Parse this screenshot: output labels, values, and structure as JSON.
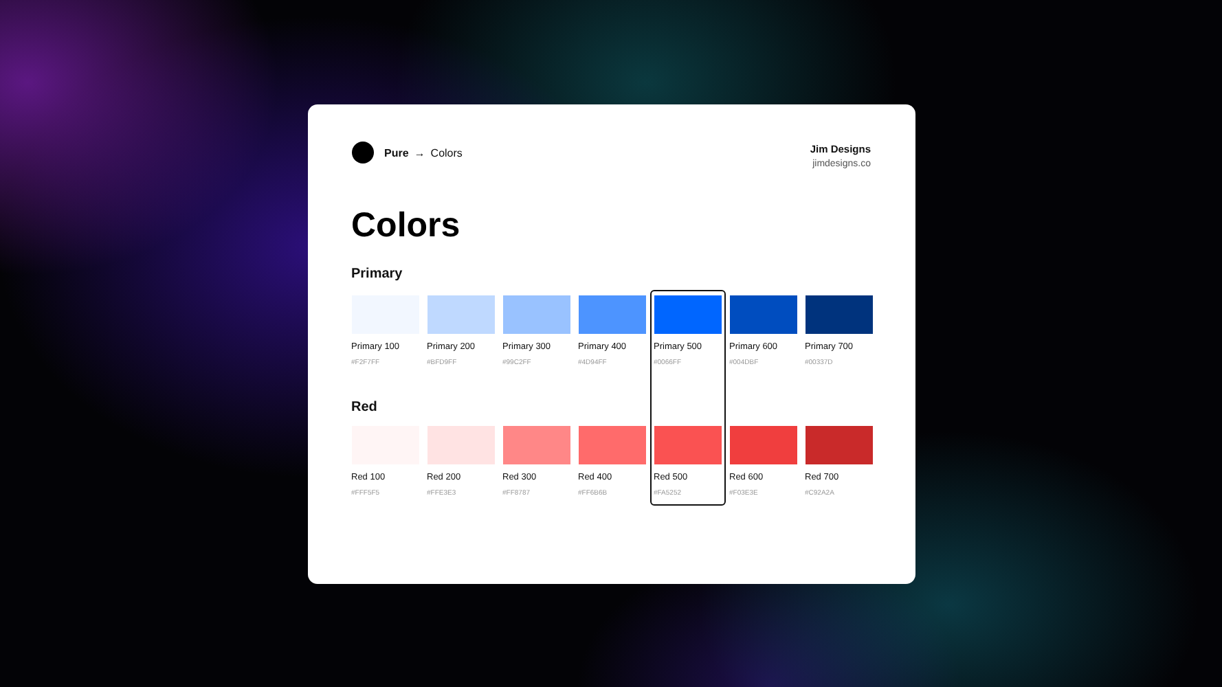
{
  "breadcrumb": {
    "root": "Pure",
    "arrow": "→",
    "page": "Colors"
  },
  "brand": {
    "name": "Jim Designs",
    "site": "jimdesigns.co"
  },
  "title": "Colors",
  "columns": [
    {
      "selected": false
    },
    {
      "selected": false
    },
    {
      "selected": false
    },
    {
      "selected": false
    },
    {
      "selected": true
    },
    {
      "selected": false
    },
    {
      "selected": false
    }
  ],
  "groups": [
    {
      "name": "Primary",
      "swatches": [
        {
          "label": "Primary 100",
          "hex": "#F2F7FF",
          "color": "#f2f7ff"
        },
        {
          "label": "Primary 200",
          "hex": "#BFD9FF",
          "color": "#bfd9ff"
        },
        {
          "label": "Primary 300",
          "hex": "#99C2FF",
          "color": "#99c2ff"
        },
        {
          "label": "Primary 400",
          "hex": "#4D94FF",
          "color": "#4d94ff"
        },
        {
          "label": "Primary 500",
          "hex": "#0066FF",
          "color": "#0066ff"
        },
        {
          "label": "Primary 600",
          "hex": "#004DBF",
          "color": "#004dbf"
        },
        {
          "label": "Primary 700",
          "hex": "#00337D",
          "color": "#00337d"
        }
      ]
    },
    {
      "name": "Red",
      "swatches": [
        {
          "label": "Red 100",
          "hex": "#FFF5F5",
          "color": "#fff5f5"
        },
        {
          "label": "Red 200",
          "hex": "#FFE3E3",
          "color": "#ffe3e3"
        },
        {
          "label": "Red 300",
          "hex": "#FF8787",
          "color": "#ff8787"
        },
        {
          "label": "Red 400",
          "hex": "#FF6B6B",
          "color": "#ff6b6b"
        },
        {
          "label": "Red 500",
          "hex": "#FA5252",
          "color": "#fa5252"
        },
        {
          "label": "Red 600",
          "hex": "#F03E3E",
          "color": "#f03e3e"
        },
        {
          "label": "Red 700",
          "hex": "#C92A2A",
          "color": "#c92a2a"
        }
      ]
    }
  ]
}
